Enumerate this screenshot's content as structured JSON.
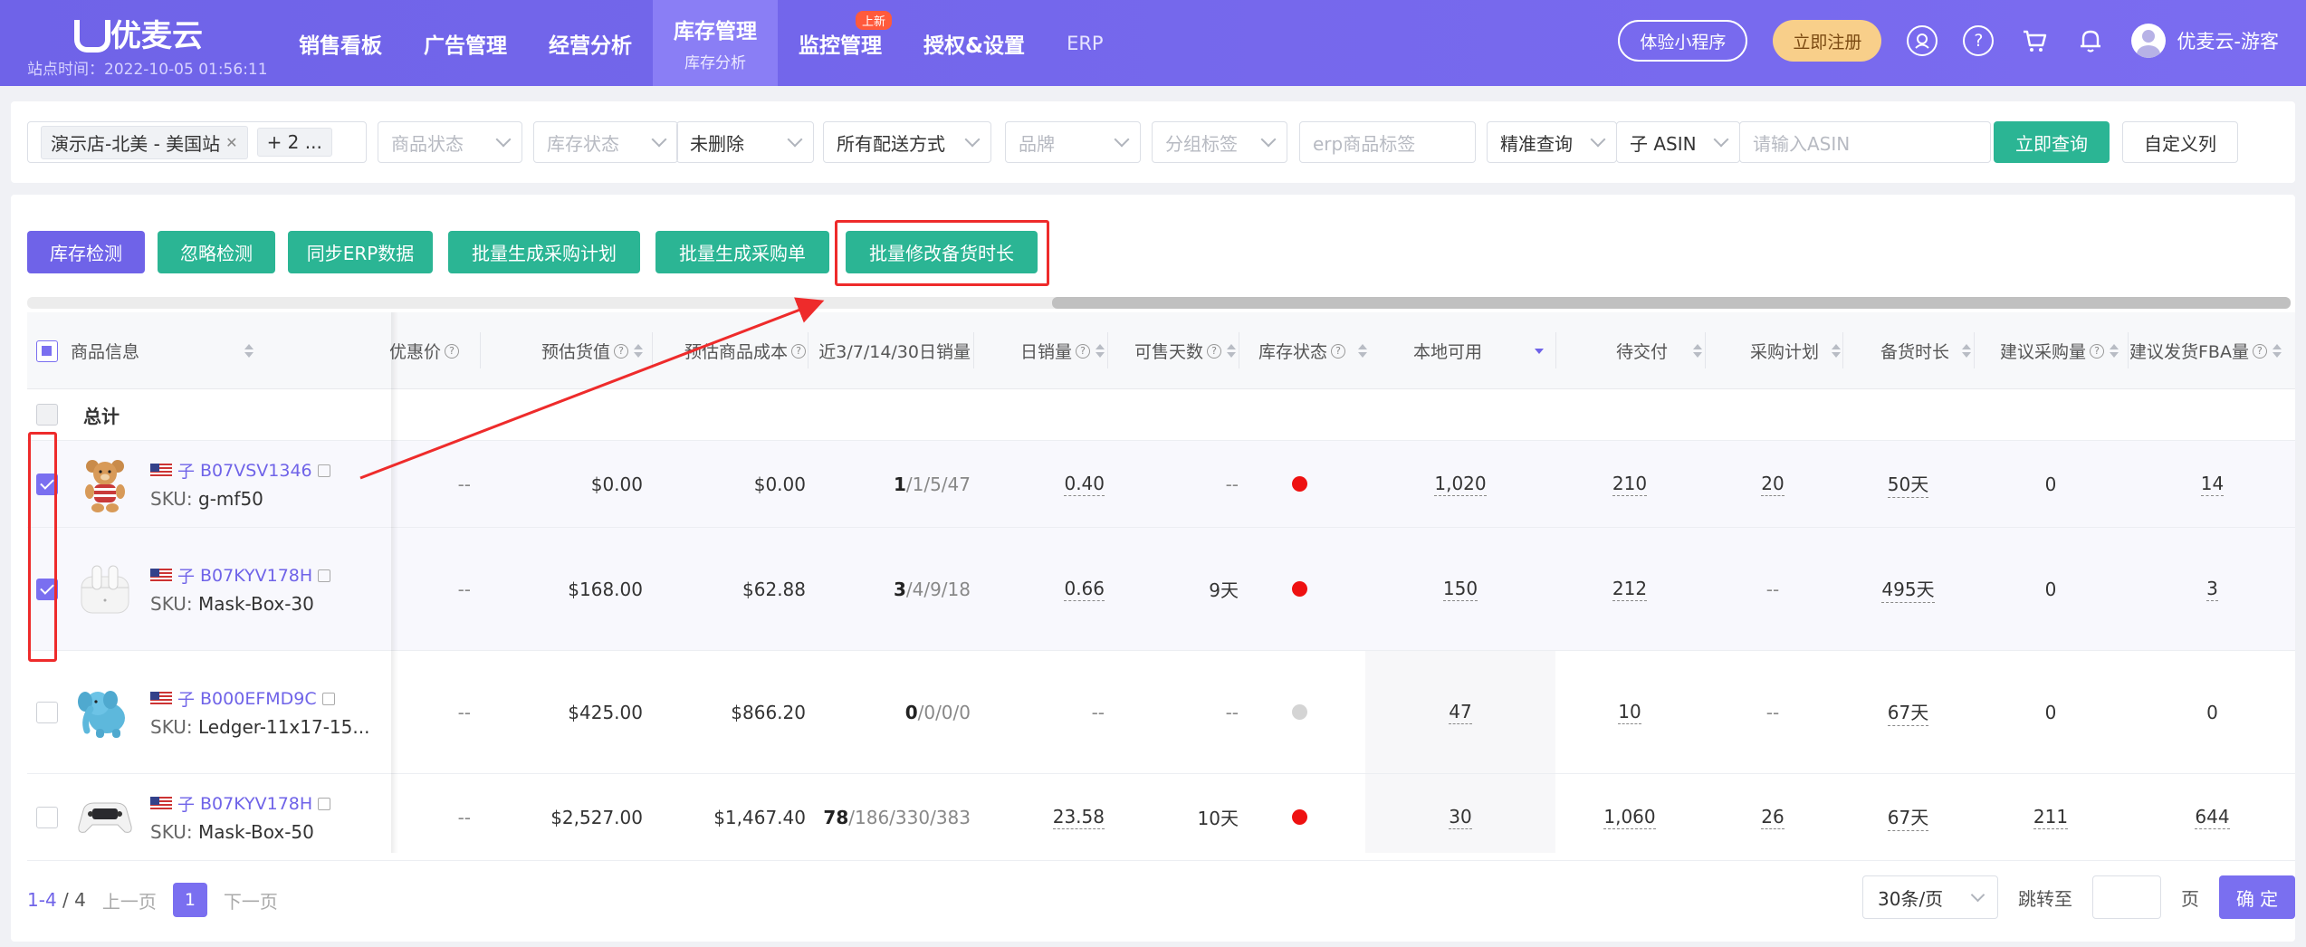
{
  "header": {
    "brand": "优麦云",
    "site_time": "站点时间：2022-10-05 01:56:11",
    "nav": [
      {
        "label": "销售看板"
      },
      {
        "label": "广告管理"
      },
      {
        "label": "经营分析"
      },
      {
        "label": "库存管理",
        "sub": "库存分析",
        "active": true
      },
      {
        "label": "监控管理",
        "badge": "上新"
      },
      {
        "label": "授权&设置"
      },
      {
        "label": "ERP"
      }
    ],
    "mini_program_btn": "体验小程序",
    "register_btn": "立即注册",
    "user_name": "优麦云-游客",
    "help_glyph": "?"
  },
  "filters": {
    "store_tag": "演示店-北美 - 美国站",
    "store_more": "+ 2 ...",
    "product_status": "商品状态",
    "stock_status": "库存状态",
    "deleted": "未删除",
    "shipping": "所有配送方式",
    "brand": "品牌",
    "group_tag": "分组标签",
    "erp_tag": "erp商品标签",
    "match_mode": "精准查询",
    "asin_type": "子 ASIN",
    "asin_placeholder": "请输入ASIN",
    "query_btn": "立即查询",
    "custom_cols_btn": "自定义列"
  },
  "actions": {
    "inventory_check": "库存检测",
    "ignore_check": "忽略检测",
    "sync_erp": "同步ERP数据",
    "gen_purchase_plan": "批量生成采购计划",
    "gen_purchase_order": "批量生成采购单",
    "edit_stock_days": "批量修改备货时长"
  },
  "table": {
    "headers": {
      "product": "商品信息",
      "discount": "优惠价",
      "est_value": "预估货值",
      "est_cost": "预估商品成本",
      "sales_windows": "近3/7/14/30日销量",
      "daily_sales": "日销量",
      "sellable_days": "可售天数",
      "stock_status": "库存状态",
      "local_available": "本地可用",
      "pending_delivery": "待交付",
      "purchase_plan": "采购计划",
      "stock_duration": "备货时长",
      "suggest_purchase": "建议采购量",
      "suggest_fba": "建议发货FBA量"
    },
    "total_label": "总计",
    "rows": [
      {
        "child_label": "子",
        "asin": "B07VSV1346",
        "sku_label": "SKU:",
        "sku": "g-mf50",
        "discount": "--",
        "est_value": "$0.00",
        "est_cost": "$0.00",
        "s3": "1",
        "s_rest": "/1/5/47",
        "daily": "0.40",
        "days": "--",
        "status": "red",
        "local": "1,020",
        "pending": "210",
        "plan": "20",
        "duration": "50天",
        "suggest": "0",
        "fba": "14",
        "checked": true,
        "img": "bear"
      },
      {
        "child_label": "子",
        "asin": "B07KYV178H",
        "sku_label": "SKU:",
        "sku": "Mask-Box-30",
        "discount": "--",
        "est_value": "$168.00",
        "est_cost": "$62.88",
        "s3": "3",
        "s_rest": "/4/9/18",
        "daily": "0.66",
        "days": "9天",
        "status": "red",
        "local": "150",
        "pending": "212",
        "plan": "--",
        "duration": "495天",
        "suggest": "0",
        "fba": "3",
        "checked": true,
        "img": "airpods"
      },
      {
        "child_label": "子",
        "asin": "B000EFMD9C",
        "sku_label": "SKU:",
        "sku": "Ledger-11x17-15...",
        "discount": "--",
        "est_value": "$425.00",
        "est_cost": "$866.20",
        "s3": "0",
        "s_rest": "/0/0/0",
        "daily": "--",
        "days": "--",
        "status": "grey",
        "local": "47",
        "pending": "10",
        "plan": "--",
        "duration": "67天",
        "suggest": "0",
        "fba": "0",
        "checked": false,
        "img": "elephant"
      },
      {
        "child_label": "子",
        "asin": "B07KYV178H",
        "sku_label": "SKU:",
        "sku": "Mask-Box-50",
        "discount": "--",
        "est_value": "$2,527.00",
        "est_cost": "$1,467.40",
        "s3": "78",
        "s_rest": "/186/330/383",
        "daily": "23.58",
        "days": "10天",
        "status": "red",
        "local": "30",
        "pending": "1,060",
        "plan": "26",
        "duration": "67天",
        "suggest": "211",
        "fba": "644",
        "checked": false,
        "img": "controller"
      }
    ]
  },
  "pagination": {
    "range": "1-4",
    "total": "/ 4",
    "prev": "上一页",
    "current": "1",
    "next": "下一页",
    "page_size": "30条/页",
    "jump_label": "跳转至",
    "page_unit": "页",
    "confirm": "确 定"
  },
  "colors": {
    "header_bg": "#7b6cf0",
    "accent_purple": "#6f63e8",
    "accent_green": "#2bb594",
    "annotation_red": "#ee2b2b"
  }
}
